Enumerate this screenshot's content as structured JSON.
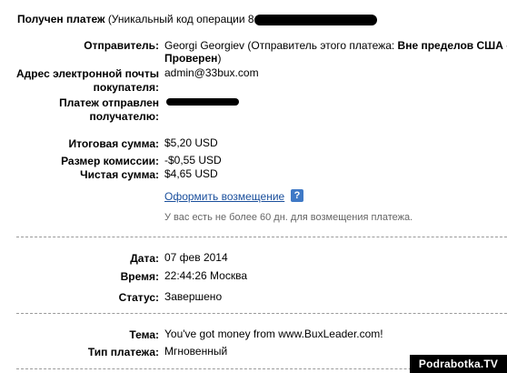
{
  "header": {
    "title": "Получен платеж",
    "op_code": "(Уникальный код операции 8."
  },
  "sender": {
    "label": "Отправитель:",
    "value_line1_prefix": "Georgi Georgiev (Отправитель этого платежа: ",
    "value_line1_bold": "Вне пределов США -",
    "value_line2_bold": "Проверен",
    "value_line2_suffix": ")"
  },
  "buyer_email": {
    "label_line1": "Адрес электронной почты",
    "label_line2": "покупателя:",
    "value": "admin@33bux.com"
  },
  "sent_to": {
    "label_line1": "Платеж отправлен",
    "label_line2": "получателю:"
  },
  "amounts": {
    "total_label": "Итоговая сумма:",
    "total_value": "$5,20 USD",
    "fee_label": "Размер комиссии:",
    "fee_value": "-$0,55 USD",
    "net_label": "Чистая сумма:",
    "net_value": "$4,65 USD"
  },
  "refund": {
    "link_label": "Оформить возмещение",
    "help_glyph": "?",
    "note": "У вас есть не более 60 дн. для возмещения платежа."
  },
  "details": {
    "date_label": "Дата:",
    "date_value": "07 фев 2014",
    "time_label": "Время:",
    "time_value": "22:44:26 Москва",
    "status_label": "Статус:",
    "status_value": "Завершено"
  },
  "message": {
    "subject_label": "Тема:",
    "subject_value": "You've got money from www.BuxLeader.com!",
    "type_label": "Тип платежа:",
    "type_value": "Мгновенный"
  },
  "watermark": "Podrabotka.TV"
}
